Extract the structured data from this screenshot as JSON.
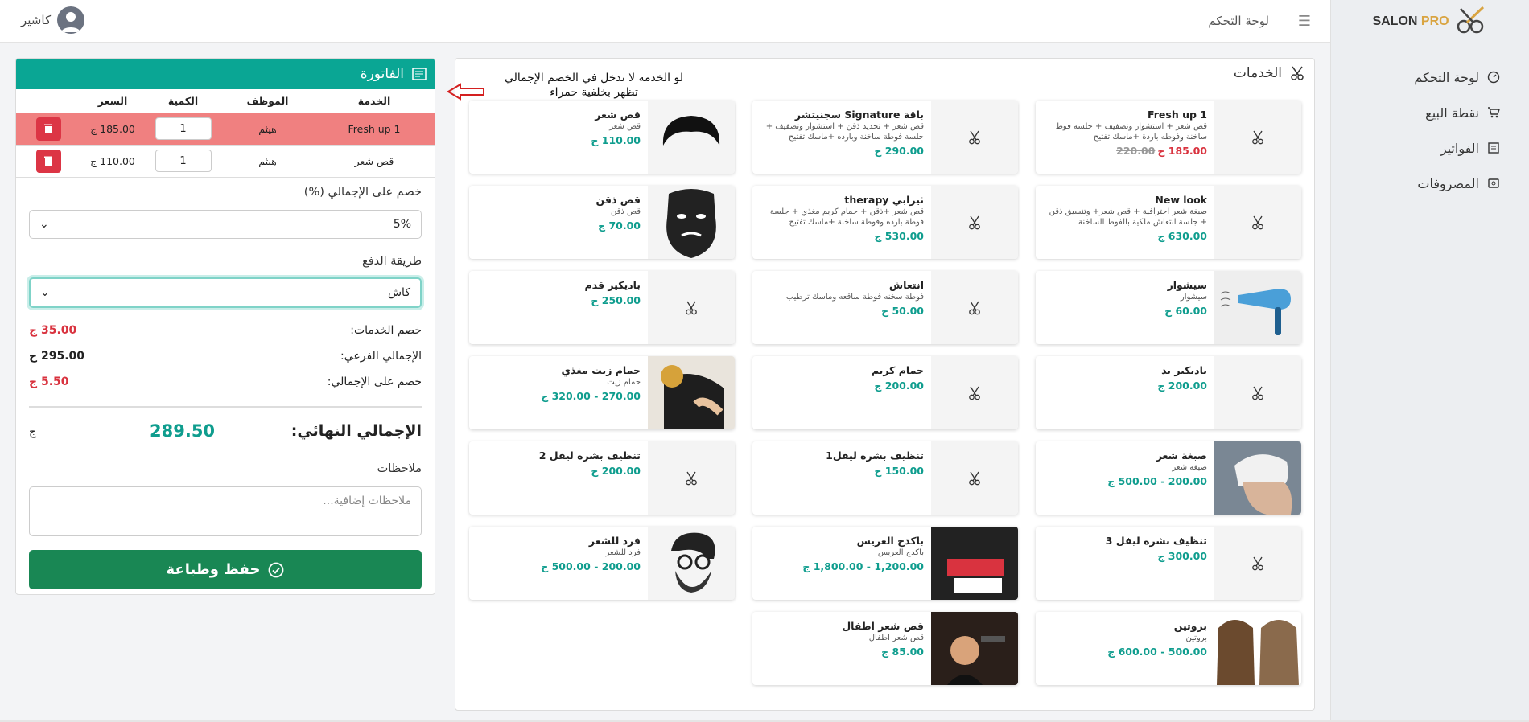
{
  "sidebar": {
    "logo_text_1": "SALON",
    "logo_text_2": "PRO",
    "items": [
      {
        "label": "لوحة التحكم",
        "icon": "dashboard-icon"
      },
      {
        "label": "نقطة البيع",
        "icon": "cart-icon"
      },
      {
        "label": "الفواتير",
        "icon": "invoice-icon"
      },
      {
        "label": "المصروفات",
        "icon": "expenses-icon"
      }
    ]
  },
  "topbar": {
    "title": "لوحة التحكم",
    "user": "كاشير"
  },
  "services": {
    "title": "الخدمات",
    "annotation": "لو الخدمة لا تدخل في الخصم الإجمالي تظهر بخلفية حمراء",
    "cards": [
      {
        "name": "Fresh up 1",
        "desc": "قص شعر + استشوار وتصفيف + جلسة فوط ساخنة وفوطه باردة +ماسك تفتيح",
        "price_new": "185.00 ج",
        "price_old": "220.00",
        "thumb": "scissors"
      },
      {
        "name": "باقة Signature سجنيتشر",
        "desc": "قص شعر + تحديد ذقن + استشوار وتصفيف + جلسة فوطة ساخنة وبارده +ماسك تفتيح",
        "price": "290.00 ج",
        "thumb": "scissors"
      },
      {
        "name": "قص شعر",
        "desc": "قص شعر",
        "price": "110.00 ج",
        "thumb": "hair"
      },
      {
        "name": "New look",
        "desc": "صبغة شعر احترافية + قص شعر+ وتنسيق ذقن + جلسة انتعاش ملكية بالفوط الساخنة",
        "price": "630.00 ج",
        "thumb": "scissors"
      },
      {
        "name": "ثيرابي therapy",
        "desc": "قص شعر +ذقن + حمام كريم مغذي + جلسة فوطة بارده وفوطة ساخنة +ماسك تفتيح",
        "price": "530.00 ج",
        "thumb": "scissors"
      },
      {
        "name": "قص ذقن",
        "desc": "قص ذقن",
        "price": "70.00 ج",
        "thumb": "beard"
      },
      {
        "name": "سيشوار",
        "desc": "سيشوار",
        "price": "60.00 ج",
        "thumb": "dryer"
      },
      {
        "name": "انتعاش",
        "desc": "فوطة سخنه فوطة ساقعه وماسك ترطيب",
        "price": "50.00 ج",
        "thumb": "scissors"
      },
      {
        "name": "باديكير قدم",
        "desc": "",
        "price": "250.00 ج",
        "thumb": "scissors"
      },
      {
        "name": "باديكير يد",
        "desc": "",
        "price": "200.00 ج",
        "thumb": "scissors"
      },
      {
        "name": "حمام كريم",
        "desc": "",
        "price": "200.00 ج",
        "thumb": "scissors"
      },
      {
        "name": "حمام زيت مغذي",
        "desc": "حمام زيت",
        "price": "270.00 - 320.00 ج",
        "thumb": "oil"
      },
      {
        "name": "صبغة شعر",
        "desc": "صبغة شعر",
        "price": "200.00 - 500.00 ج",
        "thumb": "dye"
      },
      {
        "name": "تنظيف بشره ليفل1",
        "desc": "",
        "price": "150.00 ج",
        "thumb": "scissors"
      },
      {
        "name": "تنظيف بشره ليفل 2",
        "desc": "",
        "price": "200.00 ج",
        "thumb": "scissors"
      },
      {
        "name": "تنظيف بشره ليفل 3",
        "desc": "",
        "price": "300.00 ج",
        "thumb": "scissors"
      },
      {
        "name": "باكدج العريس",
        "desc": "باكدج العريس",
        "price": "1,200.00 - 1,800.00 ج",
        "thumb": "groom"
      },
      {
        "name": "فرد للشعر",
        "desc": "فرد للشعر",
        "price": "200.00 - 500.00 ج",
        "thumb": "man"
      },
      {
        "name": "بروتين",
        "desc": "بروتين",
        "price": "500.00 - 600.00 ج",
        "thumb": "protein"
      },
      {
        "name": "قص شعر اطفال",
        "desc": "قص شعر اطفال",
        "price": "85.00 ج",
        "thumb": "kid"
      }
    ]
  },
  "invoice": {
    "title": "الفاتورة",
    "headers": {
      "service": "الخدمة",
      "employee": "الموظف",
      "qty": "الكمية",
      "price": "السعر"
    },
    "rows": [
      {
        "service": "Fresh up 1",
        "employee": "هيثم",
        "qty": "1",
        "price": "185.00 ج",
        "highlight": true
      },
      {
        "service": "قص شعر",
        "employee": "هيثم",
        "qty": "1",
        "price": "110.00 ج",
        "highlight": false
      }
    ],
    "discount_label": "خصم على الإجمالي (%)",
    "discount_value": "5%",
    "payment_label": "طريقة الدفع",
    "payment_value": "كاش",
    "services_discount_label": "خصم الخدمات:",
    "services_discount_value": "35.00 ج",
    "subtotal_label": "الإجمالي الفرعي:",
    "subtotal_value": "295.00 ج",
    "total_discount_label": "خصم على الإجمالي:",
    "total_discount_value": "5.50 ج",
    "final_label": "الإجمالي النهائي:",
    "final_value": "289.50",
    "currency": "ج",
    "notes_label": "ملاحظات",
    "notes_placeholder": "ملاحظات إضافية...",
    "save_label": "حفظ وطباعة"
  },
  "colors": {
    "accent": "#0aa694",
    "save": "#198754",
    "danger": "#dc3545",
    "highlight_row": "#f08080"
  }
}
